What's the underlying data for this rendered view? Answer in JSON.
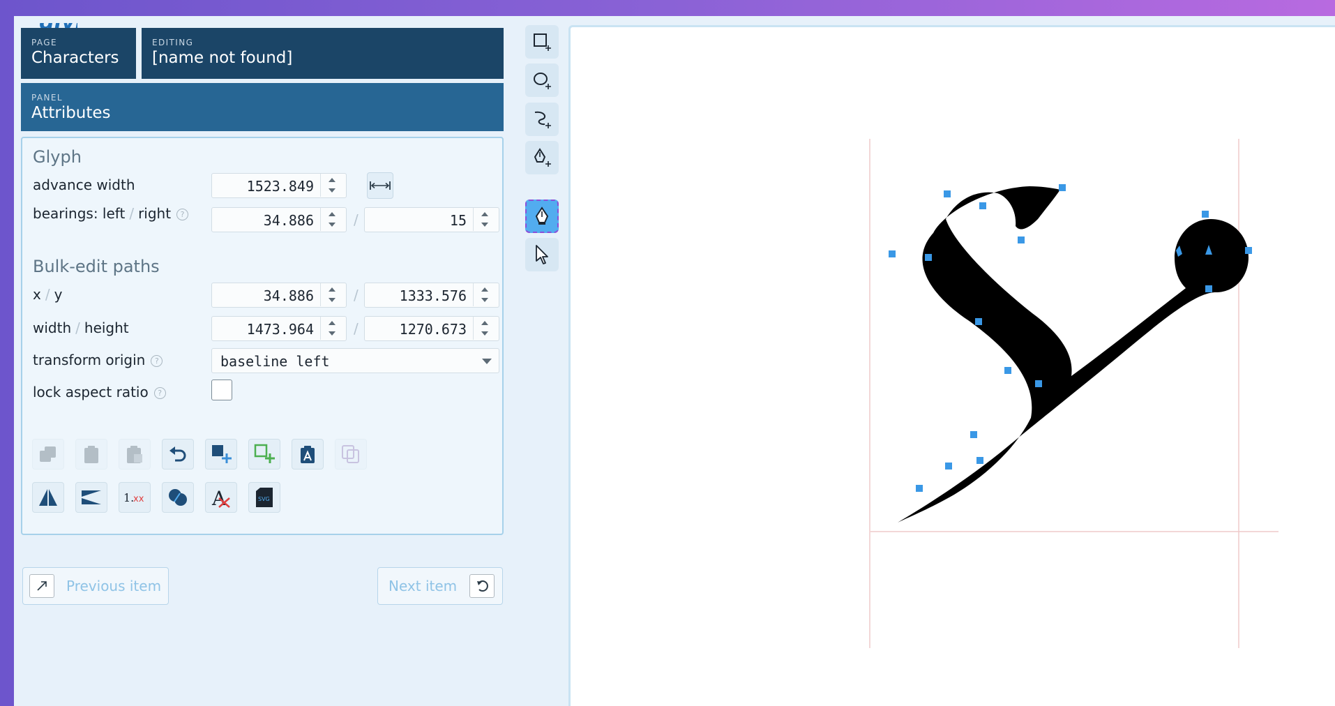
{
  "logo": {
    "text": "glyph"
  },
  "header": {
    "page_label": "PAGE",
    "page_value": "Characters",
    "editing_label": "EDITING",
    "editing_value": "[name not found]",
    "panel_label": "PANEL",
    "panel_value": "Attributes"
  },
  "glyph": {
    "title": "Glyph",
    "advance_width_label": "advance width",
    "advance_width": "1523.849",
    "bearings_label_left": "bearings: left",
    "bearings_label_sep": "/",
    "bearings_label_right": "right",
    "bearing_left": "34.886",
    "bearing_right": "15"
  },
  "bulk": {
    "title": "Bulk-edit paths",
    "x_label": "x",
    "y_label": "y",
    "sep": "/",
    "x": "34.886",
    "y": "1333.576",
    "width_label": "width",
    "height_label": "height",
    "width": "1473.964",
    "height": "1270.673",
    "transform_origin_label": "transform origin",
    "transform_origin": "baseline left",
    "lock_aspect_label": "lock aspect ratio",
    "lock_aspect": false
  },
  "help_glyph": "?",
  "nav": {
    "prev_label": "Previous item",
    "next_label": "Next item"
  },
  "colors": {
    "accent": "#52acef",
    "header": "#1b4567",
    "panel_header": "#276694",
    "handle": "#3a98e6"
  }
}
